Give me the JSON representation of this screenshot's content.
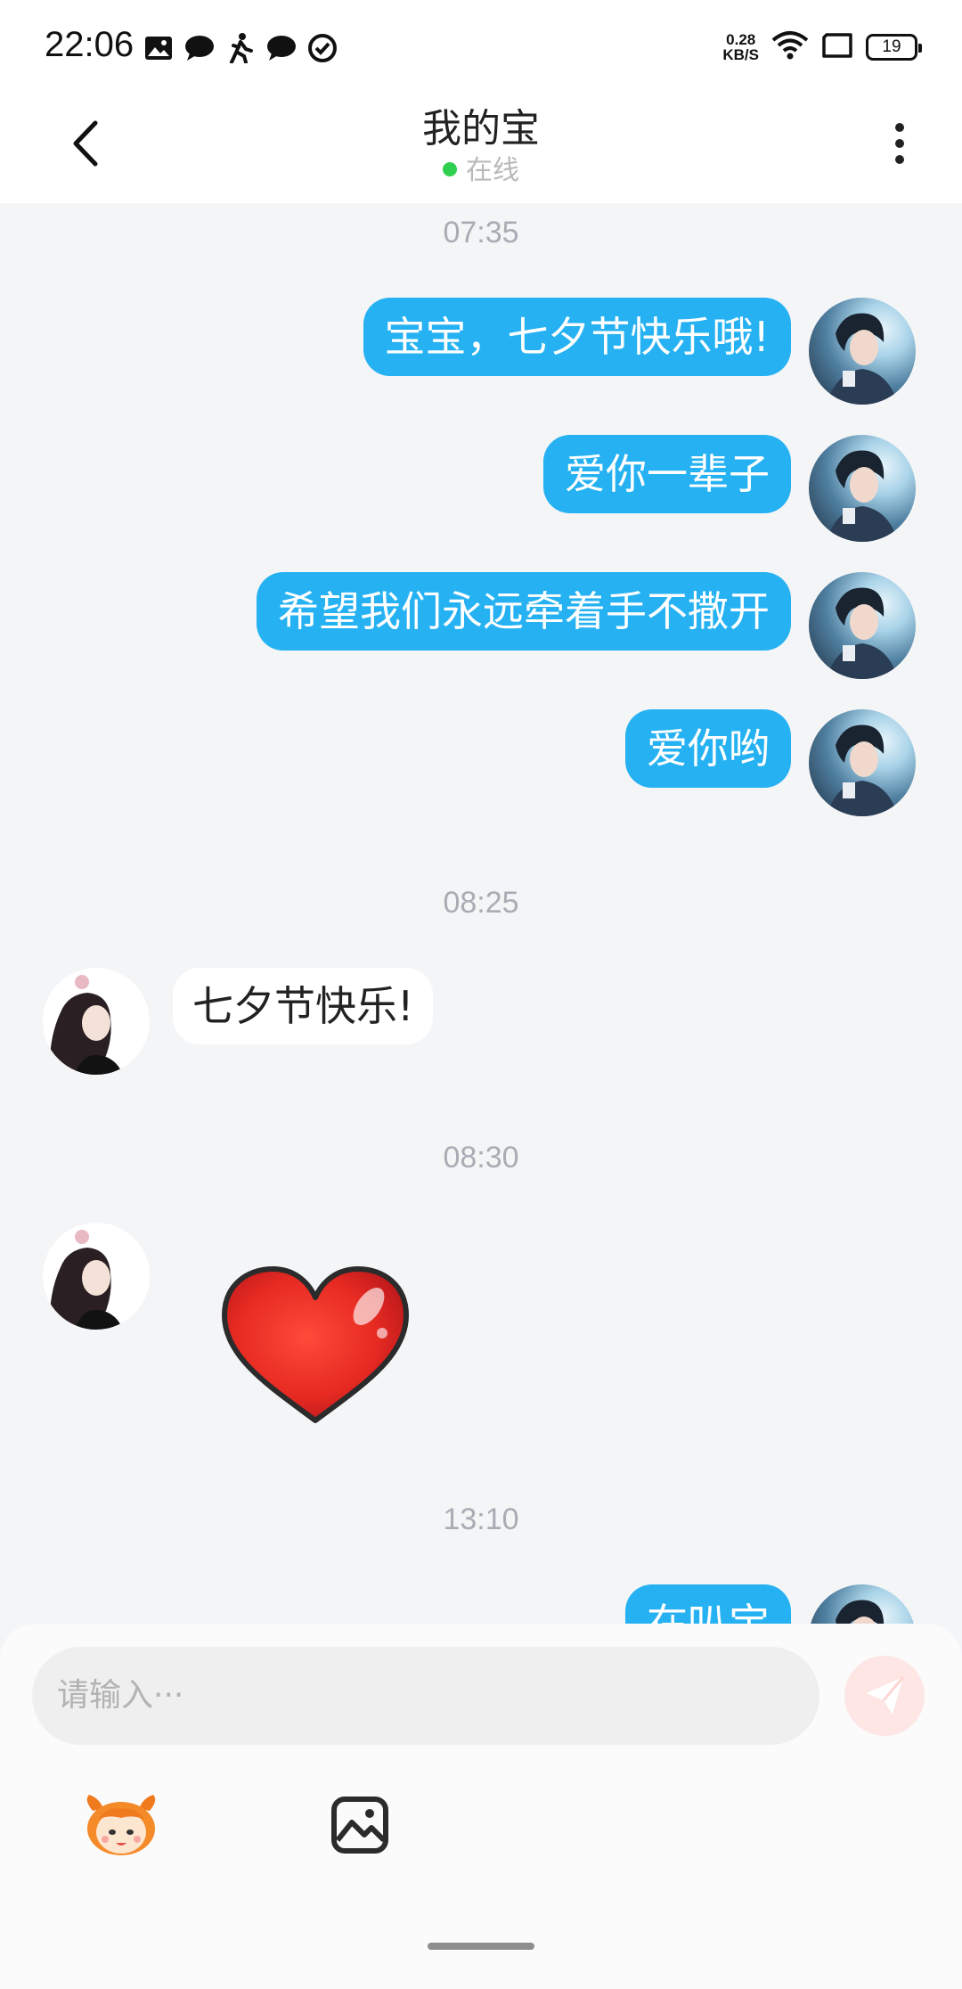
{
  "status_bar": {
    "time": "22:06",
    "icons": [
      "image-icon",
      "chat-bubble-icon",
      "walking-icon",
      "chat-bubble-icon",
      "check-circle-icon"
    ],
    "speed_value": "0.28",
    "speed_unit": "KB/S",
    "battery": "19"
  },
  "header": {
    "title": "我的宝",
    "status": "在线",
    "status_color": "#2fd04f"
  },
  "messages": {
    "ts1": "07:35",
    "m1": "宝宝，七夕节快乐哦!",
    "m2": "爱你一辈子",
    "m3": "希望我们永远牵着手不撒开",
    "m4": "爱你哟",
    "ts2": "08:25",
    "m5": "七夕节快乐!",
    "ts3": "08:30",
    "m6_sticker": "heart-sticker",
    "ts4": "13:10",
    "m7": "在叭宝"
  },
  "input": {
    "placeholder": "请输入···"
  },
  "colors": {
    "outgoing_bubble": "#26b2f2",
    "incoming_bubble": "#ffffff",
    "background": "#f4f5f7"
  }
}
